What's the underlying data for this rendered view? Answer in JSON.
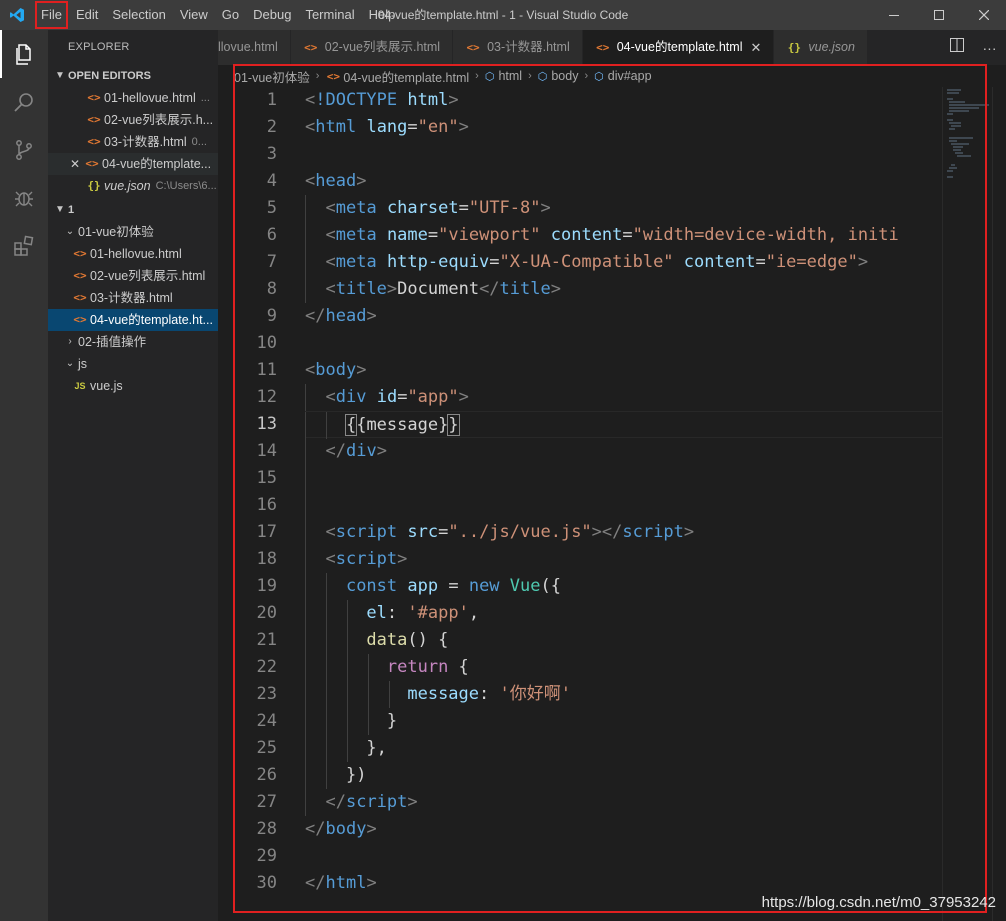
{
  "window": {
    "title": "04-vue的template.html - 1 - Visual Studio Code",
    "menu": [
      "File",
      "Edit",
      "Selection",
      "View",
      "Go",
      "Debug",
      "Terminal",
      "Help"
    ]
  },
  "sidebar": {
    "title": "EXPLORER",
    "open_editors_label": "OPEN EDITORS",
    "open_editors": [
      {
        "name": "01-hellovue.html",
        "desc": "...",
        "type": "html"
      },
      {
        "name": "02-vue列表展示.h...",
        "desc": "",
        "type": "html"
      },
      {
        "name": "03-计数器.html",
        "desc": "0...",
        "type": "html"
      },
      {
        "name": "04-vue的template...",
        "desc": "",
        "type": "html"
      },
      {
        "name": "vue.json",
        "desc": "C:\\Users\\6...",
        "type": "json"
      }
    ],
    "workspace_label": "1",
    "tree": {
      "folder1": "01-vue初体验",
      "files1": [
        "01-hellovue.html",
        "02-vue列表展示.html",
        "03-计数器.html",
        "04-vue的template.ht..."
      ],
      "folder2": "02-插值操作",
      "folder3": "js",
      "files3": [
        "vue.js"
      ]
    }
  },
  "tabs": [
    {
      "label": "llovue.html",
      "type": "html",
      "active": false
    },
    {
      "label": "02-vue列表展示.html",
      "type": "html",
      "active": false
    },
    {
      "label": "03-计数器.html",
      "type": "html",
      "active": false
    },
    {
      "label": "04-vue的template.html",
      "type": "html",
      "active": true
    },
    {
      "label": "vue.json",
      "type": "json",
      "active": false
    }
  ],
  "breadcrumb": [
    "01-vue初体验",
    "04-vue的template.html",
    "html",
    "body",
    "div#app"
  ],
  "editor": {
    "line_numbers": [
      "1",
      "2",
      "3",
      "4",
      "5",
      "6",
      "7",
      "8",
      "9",
      "10",
      "11",
      "12",
      "13",
      "14",
      "15",
      "16",
      "17",
      "18",
      "19",
      "20",
      "21",
      "22",
      "23",
      "24",
      "25",
      "26",
      "27",
      "28",
      "29",
      "30"
    ],
    "current_line": "13",
    "code": {
      "l1_doctype": "!DOCTYPE",
      "l1_html": "html",
      "html_tag": "html",
      "lang_attr": "lang",
      "lang_val": "\"en\"",
      "head_tag": "head",
      "meta_tag": "meta",
      "charset_attr": "charset",
      "charset_val": "\"UTF-8\"",
      "name_attr": "name",
      "viewport_val": "\"viewport\"",
      "content_attr": "content",
      "content_val": "\"width=device-width, initi",
      "httpequiv_attr": "http-equiv",
      "xua_val": "\"X-UA-Compatible\"",
      "ie_val": "\"ie=edge\"",
      "title_tag": "title",
      "title_text": "Document",
      "body_tag": "body",
      "div_tag": "div",
      "id_attr": "id",
      "id_val": "\"app\"",
      "mustache_open": "{",
      "mustache_inner": "{message}",
      "mustache_close": "}",
      "script_tag": "script",
      "src_attr": "src",
      "src_val": "\"../js/vue.js\"",
      "const_kw": "const",
      "app_var": "app",
      "eq": " = ",
      "new_kw": "new",
      "vue_cls": "Vue",
      "paren_open": "({",
      "el_key": "el",
      "el_val": "'#app'",
      "data_fn": "data",
      "data_rest": "() {",
      "return_kw": "return",
      "brace_open": " {",
      "message_key": "message",
      "message_val": "'你好啊'",
      "brace_close": "}",
      "brace_close_comma": "},",
      "paren_close": "})"
    }
  },
  "watermark": "https://blog.csdn.net/m0_37953242"
}
